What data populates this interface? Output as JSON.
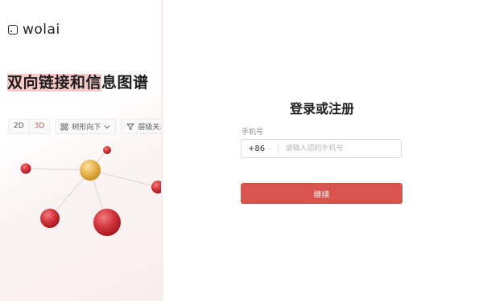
{
  "brand": {
    "name": "wolai"
  },
  "promo": {
    "headline_highlight_1": "双向链接和信",
    "headline_rest": "息图谱",
    "view_modes": [
      "2D",
      "3D"
    ],
    "active_view": "3D",
    "layout_label": "树形向下",
    "filter_label": "层级关系"
  },
  "login": {
    "title": "登录或注册",
    "phone_label": "手机号",
    "country_code": "+86",
    "phone_placeholder": "请输入您的手机号",
    "continue_label": "继续"
  },
  "colors": {
    "accent": "#d9534f",
    "node_red": "#d0343a",
    "node_gold": "#e8b24a",
    "highlight": "#f7c9c9"
  }
}
